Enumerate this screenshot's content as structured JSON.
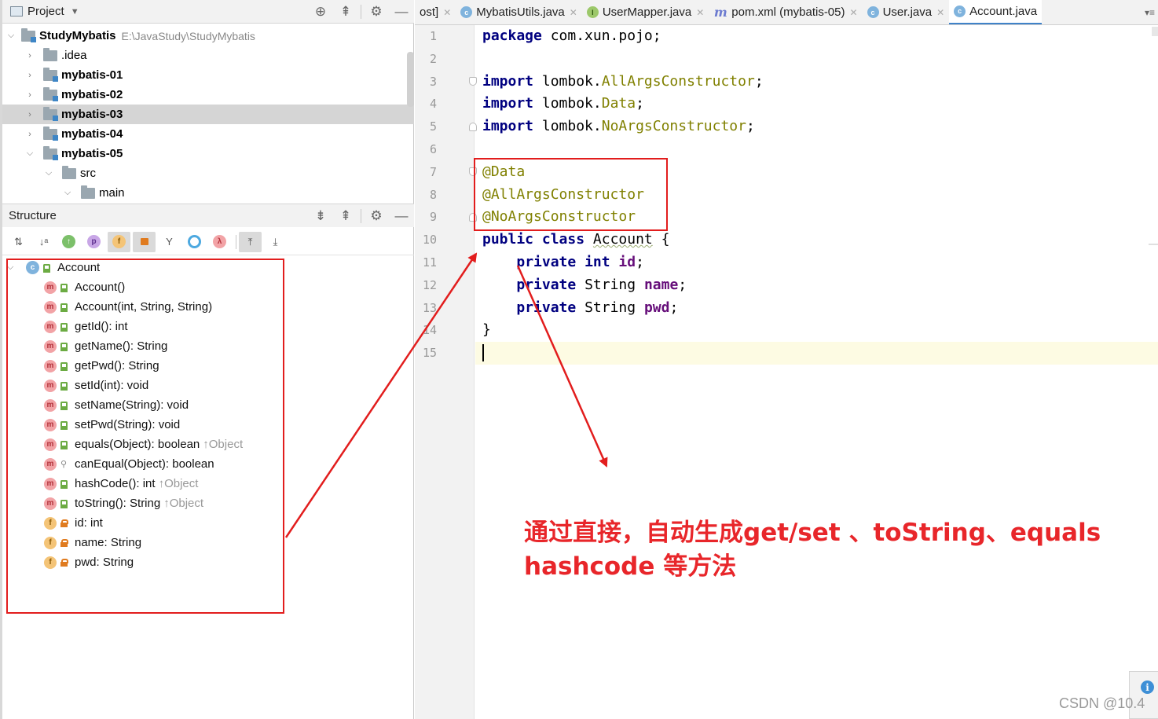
{
  "project_panel": {
    "title": "Project",
    "root": {
      "name": "StudyMybatis",
      "path": "E:\\JavaStudy\\StudyMybatis"
    },
    "items": [
      {
        "label": ".idea"
      },
      {
        "label": "mybatis-01"
      },
      {
        "label": "mybatis-02"
      },
      {
        "label": "mybatis-03"
      },
      {
        "label": "mybatis-04"
      },
      {
        "label": "mybatis-05"
      },
      {
        "label": "src"
      },
      {
        "label": "main"
      }
    ]
  },
  "structure_panel": {
    "title": "Structure",
    "toolbar": [
      {
        "icon": "sort-by-type-icon"
      },
      {
        "icon": "sort-alphabetically-icon"
      },
      {
        "icon": "show-inherited-icon"
      },
      {
        "icon": "show-properties-icon"
      },
      {
        "icon": "show-fields-icon"
      },
      {
        "icon": "show-non-public-icon"
      },
      {
        "icon": "show-anonymous-icon"
      },
      {
        "icon": "show-lambdas-icon"
      },
      {
        "icon": "lambda-icon"
      },
      {
        "icon": "autoscroll-to-source-icon"
      },
      {
        "icon": "autoscroll-from-source-icon"
      }
    ],
    "class_name": "Account",
    "members": [
      {
        "kind": "method",
        "text": "Account()",
        "inherit": ""
      },
      {
        "kind": "method",
        "text": "Account(int, String, String)",
        "inherit": ""
      },
      {
        "kind": "method",
        "text": "getId(): int",
        "inherit": ""
      },
      {
        "kind": "method",
        "text": "getName(): String",
        "inherit": ""
      },
      {
        "kind": "method",
        "text": "getPwd(): String",
        "inherit": ""
      },
      {
        "kind": "method",
        "text": "setId(int): void",
        "inherit": ""
      },
      {
        "kind": "method",
        "text": "setName(String): void",
        "inherit": ""
      },
      {
        "kind": "method",
        "text": "setPwd(String): void",
        "inherit": ""
      },
      {
        "kind": "method",
        "text": "equals(Object): boolean",
        "inherit": "↑Object"
      },
      {
        "kind": "method",
        "text": "canEqual(Object): boolean",
        "inherit": ""
      },
      {
        "kind": "method",
        "text": "hashCode(): int",
        "inherit": "↑Object"
      },
      {
        "kind": "method",
        "text": "toString(): String",
        "inherit": "↑Object"
      },
      {
        "kind": "field",
        "text": "id: int",
        "inherit": ""
      },
      {
        "kind": "field",
        "text": "name: String",
        "inherit": ""
      },
      {
        "kind": "field",
        "text": "pwd: String",
        "inherit": ""
      }
    ]
  },
  "tabs": [
    {
      "label": "ost]",
      "icon": "",
      "active": false
    },
    {
      "label": "MybatisUtils.java",
      "icon": "class-icon",
      "active": false
    },
    {
      "label": "UserMapper.java",
      "icon": "interface-icon",
      "active": false
    },
    {
      "label": "pom.xml (mybatis-05)",
      "icon": "maven-icon",
      "active": false
    },
    {
      "label": "User.java",
      "icon": "class-icon",
      "active": false
    },
    {
      "label": "Account.java",
      "icon": "class-icon",
      "active": true
    }
  ],
  "editor": {
    "line_numbers": [
      "1",
      "2",
      "3",
      "4",
      "5",
      "6",
      "7",
      "8",
      "9",
      "10",
      "11",
      "12",
      "13",
      "14",
      "15"
    ],
    "tokens": {
      "package": "package",
      "package_name": "com.xun.pojo;",
      "import": "import",
      "lombok": "lombok.",
      "AllArgsConstructor": "AllArgsConstructor",
      "Data": "Data",
      "NoArgsConstructor": "NoArgsConstructor",
      "semi": ";",
      "at_data": "@Data",
      "at_allargs": "@AllArgsConstructor",
      "at_noargs": "@NoArgsConstructor",
      "public": "public",
      "class": "class",
      "class_name": "Account",
      "open_brace": "{",
      "close_brace": "}",
      "private": "private",
      "int": "int",
      "String": "String",
      "id": "id",
      "name": "name",
      "pwd": "pwd"
    }
  },
  "annotation": {
    "line1": "通过直接，自动生成get/set 、toString、equals",
    "line2": "hashcode  等方法",
    "color": "#e8262a"
  },
  "watermark": "CSDN @10.4",
  "colors": {
    "keyword": "#000080",
    "annotation": "#808000",
    "field": "#660e7a",
    "highlight_box": "#e21d1d"
  }
}
